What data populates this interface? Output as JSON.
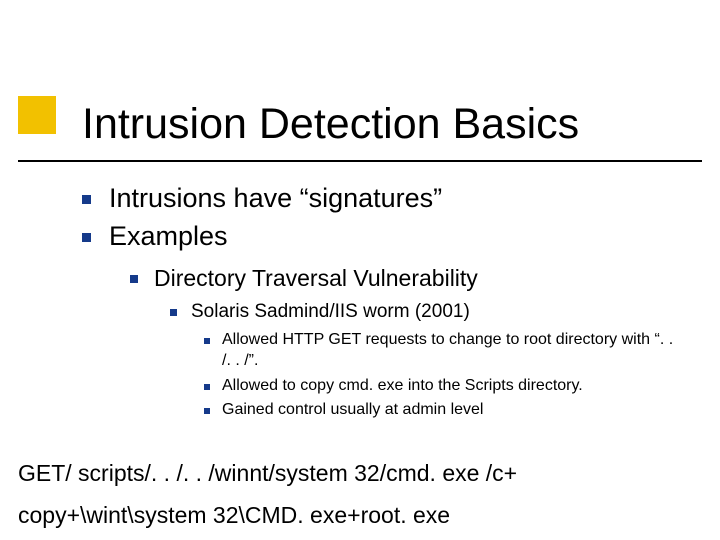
{
  "title": "Intrusion Detection Basics",
  "body": {
    "item1": "Intrusions have “signatures”",
    "item2": "Examples",
    "sub1": "Directory Traversal Vulnerability",
    "subsub1": "Solaris Sadmind/IIS worm (2001)",
    "detail1": "Allowed HTTP GET requests to change to root directory with “. . /. . /”.",
    "detail2": "Allowed to copy cmd. exe into the Scripts directory.",
    "detail3": "Gained control usually at admin level"
  },
  "footer": {
    "line1": "GET/ scripts/. . /. . /winnt/system 32/cmd. exe /c+",
    "line2": "copy+\\wint\\system 32\\CMD. exe+root. exe"
  }
}
